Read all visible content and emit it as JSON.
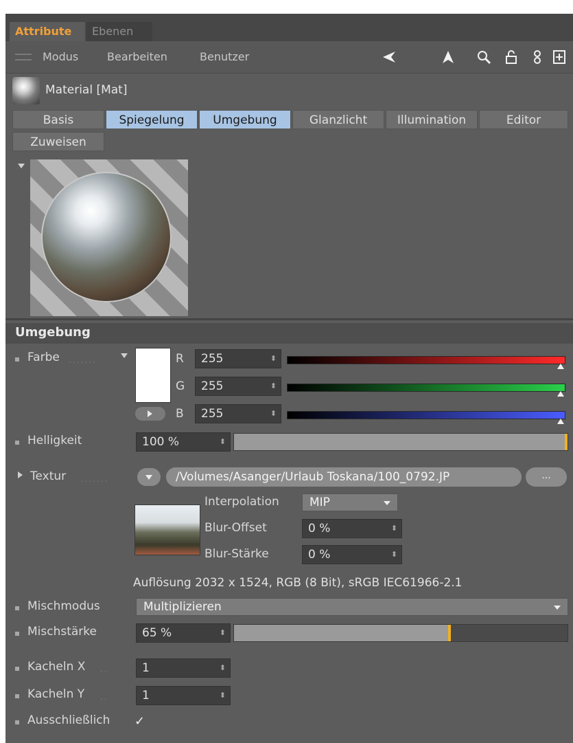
{
  "tabs": {
    "attribute": "Attribute",
    "ebenen": "Ebenen"
  },
  "menu": {
    "modus": "Modus",
    "bearbeiten": "Bearbeiten",
    "benutzer": "Benutzer"
  },
  "toolbar_icons": [
    "back-arrow-icon",
    "pointer-up-icon",
    "search-icon",
    "lock-icon",
    "link-icon",
    "new-window-icon"
  ],
  "material": {
    "title": "Material [Mat]"
  },
  "channel_tabs": [
    {
      "label": "Basis",
      "selected": false
    },
    {
      "label": "Spiegelung",
      "selected": true
    },
    {
      "label": "Umgebung",
      "selected": true
    },
    {
      "label": "Glanzlicht",
      "selected": false
    },
    {
      "label": "Illumination",
      "selected": false
    },
    {
      "label": "Editor",
      "selected": false
    },
    {
      "label": "Zuweisen",
      "selected": false
    }
  ],
  "section": {
    "title": "Umgebung"
  },
  "color": {
    "label": "Farbe",
    "r_label": "R",
    "g_label": "G",
    "b_label": "B",
    "r": "255",
    "g": "255",
    "b": "255",
    "swatch": "#ffffff"
  },
  "helligkeit": {
    "label": "Helligkeit",
    "value": "100 %",
    "level": 1.0
  },
  "textur": {
    "label": "Textur",
    "path": "/Volumes/Asanger/Urlaub Toskana/100_0792.JP",
    "more": "...",
    "interpolation_label": "Interpolation",
    "interpolation_value": "MIP",
    "blur_offset_label": "Blur-Offset",
    "blur_offset_value": "0 %",
    "blur_staerke_label": "Blur-Stärke",
    "blur_staerke_value": "0 %",
    "info": "Auflösung 2032 x 1524, RGB (8 Bit), sRGB IEC61966-2.1"
  },
  "mischmodus": {
    "label": "Mischmodus",
    "value": "Multiplizieren"
  },
  "mischstaerke": {
    "label": "Mischstärke",
    "value": "65 %",
    "level": 0.65
  },
  "kacheln_x": {
    "label": "Kacheln X",
    "value": "1"
  },
  "kacheln_y": {
    "label": "Kacheln Y",
    "value": "1"
  },
  "ausschliesslich": {
    "label": "Ausschließlich",
    "checked": true,
    "check_glyph": "✓"
  },
  "colors": {
    "accent": "#f0a038",
    "tab_selected": "#a8c4e4",
    "slider_knob": "#f0b020"
  }
}
